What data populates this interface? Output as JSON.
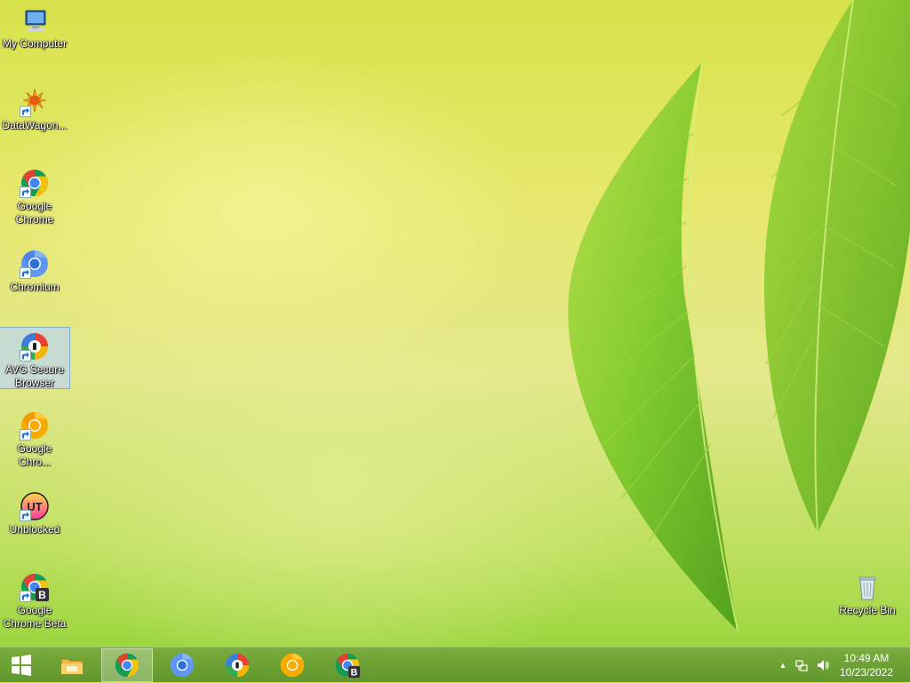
{
  "desktop": {
    "icons": [
      {
        "label": "My Computer",
        "icon": "computer-icon"
      },
      {
        "label": "DataWagon...",
        "icon": "datawagon-icon"
      },
      {
        "label": "Google Chrome",
        "icon": "chrome-icon"
      },
      {
        "label": "Chromium",
        "icon": "chromium-icon"
      },
      {
        "label": "AVG Secure Browser",
        "icon": "avg-browser-icon"
      },
      {
        "label": "Google Chro...",
        "icon": "chrome-canary-icon"
      },
      {
        "label": "Unblocked",
        "icon": "unblocked-icon"
      },
      {
        "label": "Google Chrome Beta",
        "icon": "chrome-beta-icon"
      }
    ],
    "recycle_bin": {
      "label": "Recycle Bin",
      "icon": "recycle-bin-icon"
    },
    "selected_icon": "AVG Secure Browser"
  },
  "taskbar": {
    "start": {
      "icon": "windows-start-icon"
    },
    "pinned": [
      {
        "name": "file-explorer",
        "icon": "folder-icon",
        "active": false
      },
      {
        "name": "google-chrome",
        "icon": "chrome-icon",
        "active": true
      },
      {
        "name": "chromium",
        "icon": "chromium-icon",
        "active": false
      },
      {
        "name": "avg-secure-browser",
        "icon": "avg-browser-icon",
        "active": false
      },
      {
        "name": "chrome-canary",
        "icon": "chrome-canary-icon",
        "active": false
      },
      {
        "name": "chrome-beta",
        "icon": "chrome-beta-icon",
        "active": false
      }
    ],
    "tray": {
      "icons": [
        "show-hidden-icons-chevron",
        "network-icon",
        "volume-icon"
      ]
    },
    "clock": {
      "time": "10:49 AM",
      "date": "10/23/2022"
    }
  },
  "colors": {
    "chrome_red": "#db4437",
    "chrome_yellow": "#f4c20d",
    "chrome_green": "#0f9d58",
    "chrome_blue": "#4285f4",
    "chromium_blue": "#5e97f6",
    "canary_yellow": "#f9ab00"
  }
}
